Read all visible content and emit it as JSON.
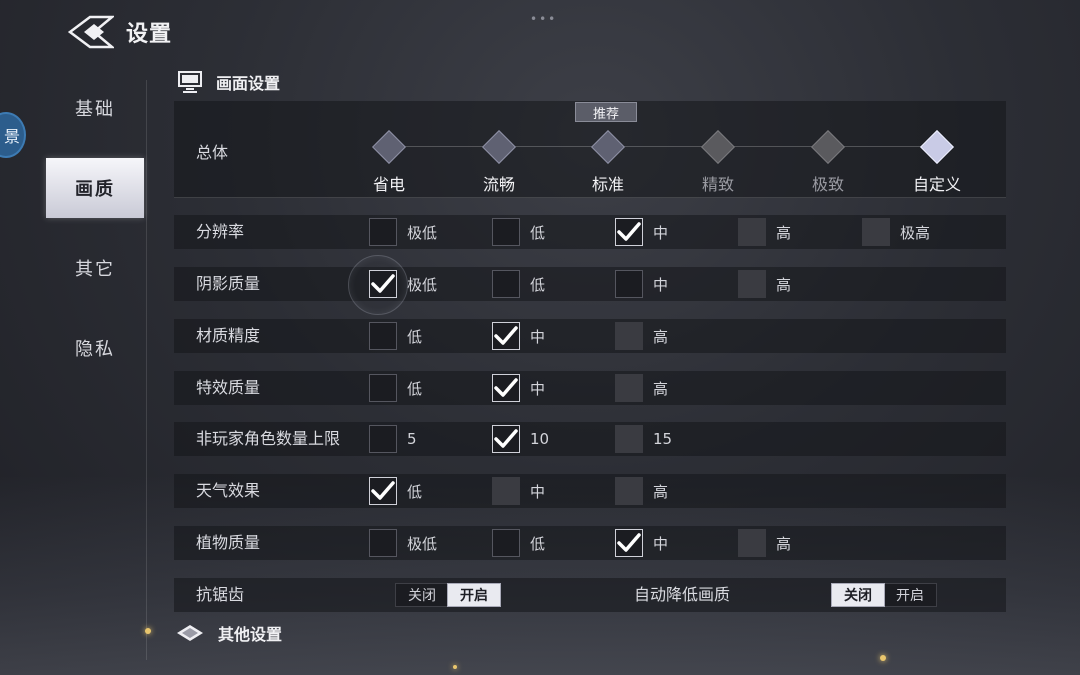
{
  "header": {
    "title": "设置"
  },
  "drag_handle": "•••",
  "edge_badge_glyph": "景",
  "sidebar": {
    "items": [
      {
        "label": "基础",
        "active": false
      },
      {
        "label": "画质",
        "active": true
      },
      {
        "label": "其它",
        "active": false
      },
      {
        "label": "隐私",
        "active": false
      }
    ]
  },
  "section_graphics": {
    "title": "画面设置"
  },
  "section_other": {
    "title": "其他设置"
  },
  "overall": {
    "label": "总体",
    "recommend_badge": "推荐",
    "presets": [
      {
        "label": "省电",
        "state": "normal"
      },
      {
        "label": "流畅",
        "state": "normal"
      },
      {
        "label": "标准",
        "state": "normal"
      },
      {
        "label": "精致",
        "state": "disabled"
      },
      {
        "label": "极致",
        "state": "disabled"
      },
      {
        "label": "自定义",
        "state": "selected"
      }
    ]
  },
  "rows": [
    {
      "label": "分辨率",
      "options": [
        {
          "label": "极低",
          "state": "off"
        },
        {
          "label": "低",
          "state": "off"
        },
        {
          "label": "中",
          "state": "on"
        },
        {
          "label": "高",
          "state": "disabled"
        },
        {
          "label": "极高",
          "state": "disabled"
        }
      ]
    },
    {
      "label": "阴影质量",
      "options": [
        {
          "label": "极低",
          "state": "on"
        },
        {
          "label": "低",
          "state": "off"
        },
        {
          "label": "中",
          "state": "off"
        },
        {
          "label": "高",
          "state": "disabled"
        }
      ]
    },
    {
      "label": "材质精度",
      "options": [
        {
          "label": "低",
          "state": "off"
        },
        {
          "label": "中",
          "state": "on"
        },
        {
          "label": "高",
          "state": "disabled"
        }
      ]
    },
    {
      "label": "特效质量",
      "options": [
        {
          "label": "低",
          "state": "off"
        },
        {
          "label": "中",
          "state": "on"
        },
        {
          "label": "高",
          "state": "disabled"
        }
      ]
    },
    {
      "label": "非玩家角色数量上限",
      "options": [
        {
          "label": "5",
          "state": "off"
        },
        {
          "label": "10",
          "state": "on"
        },
        {
          "label": "15",
          "state": "disabled"
        }
      ]
    },
    {
      "label": "天气效果",
      "options": [
        {
          "label": "低",
          "state": "on"
        },
        {
          "label": "中",
          "state": "disabled"
        },
        {
          "label": "高",
          "state": "disabled"
        }
      ]
    },
    {
      "label": "植物质量",
      "options": [
        {
          "label": "极低",
          "state": "off"
        },
        {
          "label": "低",
          "state": "off"
        },
        {
          "label": "中",
          "state": "on"
        },
        {
          "label": "高",
          "state": "disabled"
        }
      ]
    }
  ],
  "antialias": {
    "label": "抗锯齿",
    "off_label": "关闭",
    "on_label": "开启",
    "selected": "on"
  },
  "auto_lower": {
    "label": "自动降低画质",
    "off_label": "关闭",
    "on_label": "开启",
    "selected": "off"
  },
  "colors": {
    "accent": "#e9eaf0",
    "preset_normal": "#5f6172",
    "preset_disabled": "#5a5a5e",
    "preset_selected": "#c9cbe6",
    "spark": "#e9c66d"
  }
}
